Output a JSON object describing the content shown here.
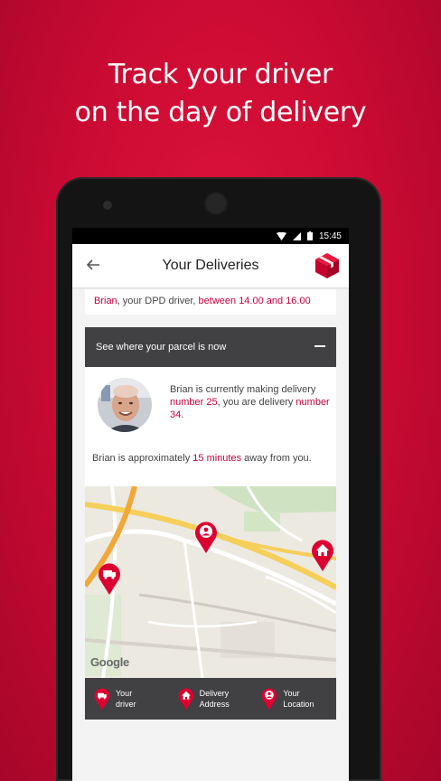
{
  "headline": {
    "line1": "Track your driver",
    "line2": "on the day of delivery"
  },
  "status_bar": {
    "time": "15:45",
    "icons": [
      "wifi-icon",
      "signal-icon",
      "battery-icon"
    ]
  },
  "app_bar": {
    "title": "Your Deliveries",
    "back_icon": "arrow-left-icon",
    "logo_icon": "dpd-cube-logo"
  },
  "delivery_window": {
    "driver": "Brian",
    "text1": ", your DPD driver, ",
    "window": "between 14.00 and 16.00"
  },
  "parcel_section": {
    "title": "See where your parcel is now",
    "toggle_icon": "minus-icon"
  },
  "driver_status": {
    "text1": "Brian is currently making delivery ",
    "current": "number 25",
    "text2": ", you are delivery ",
    "yours": "number 34",
    "text3": "."
  },
  "eta": {
    "text1": "Brian is approximately ",
    "minutes": "15 minutes",
    "text2": " away from you."
  },
  "map": {
    "attribution": "Google",
    "markers": [
      "van-pin-icon",
      "driver-person-pin-icon",
      "home-pin-icon"
    ]
  },
  "legend": [
    {
      "label": "Your\ndriver",
      "icon": "van-pin-icon"
    },
    {
      "label": "Delivery\nAddress",
      "icon": "home-pin-icon"
    },
    {
      "label": "Your\nLocation",
      "icon": "person-pin-icon"
    }
  ],
  "colors": {
    "brand_red": "#dc0032",
    "dark_bar": "#414042",
    "highlight": "#c8003c"
  }
}
